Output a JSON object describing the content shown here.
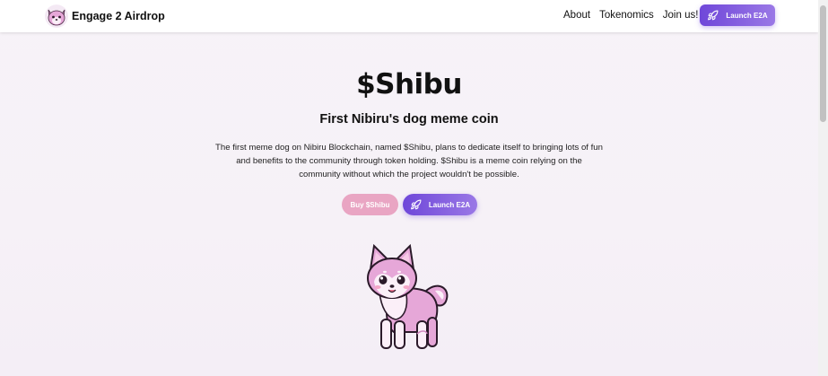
{
  "navbar": {
    "brand": "Engage 2 Airdrop",
    "links": [
      "About",
      "Tokenomics",
      "Join us!"
    ],
    "launch_label": "Launch E2A"
  },
  "hero": {
    "title": "$Shibu",
    "subtitle": "First Nibiru's dog meme coin",
    "description": "The first meme dog on Nibiru Blockchain, named $Shibu, plans to dedicate itself to bringing lots of fun and benefits to the community through token holding. $Shibu is a meme coin relying on the community without which the project wouldn't be possible.",
    "buy_label": "Buy $Shibu",
    "launch_label": "Launch E2A"
  },
  "icons": {
    "logo": "shiba-logo-icon",
    "rocket": "rocket-icon",
    "mascot": "shiba-mascot-illustration"
  },
  "colors": {
    "accent_start": "#6f47d9",
    "accent_end": "#9a78e6",
    "buy_pink": "#e9a5c3",
    "shiba_pink": "#e6a7d8"
  }
}
